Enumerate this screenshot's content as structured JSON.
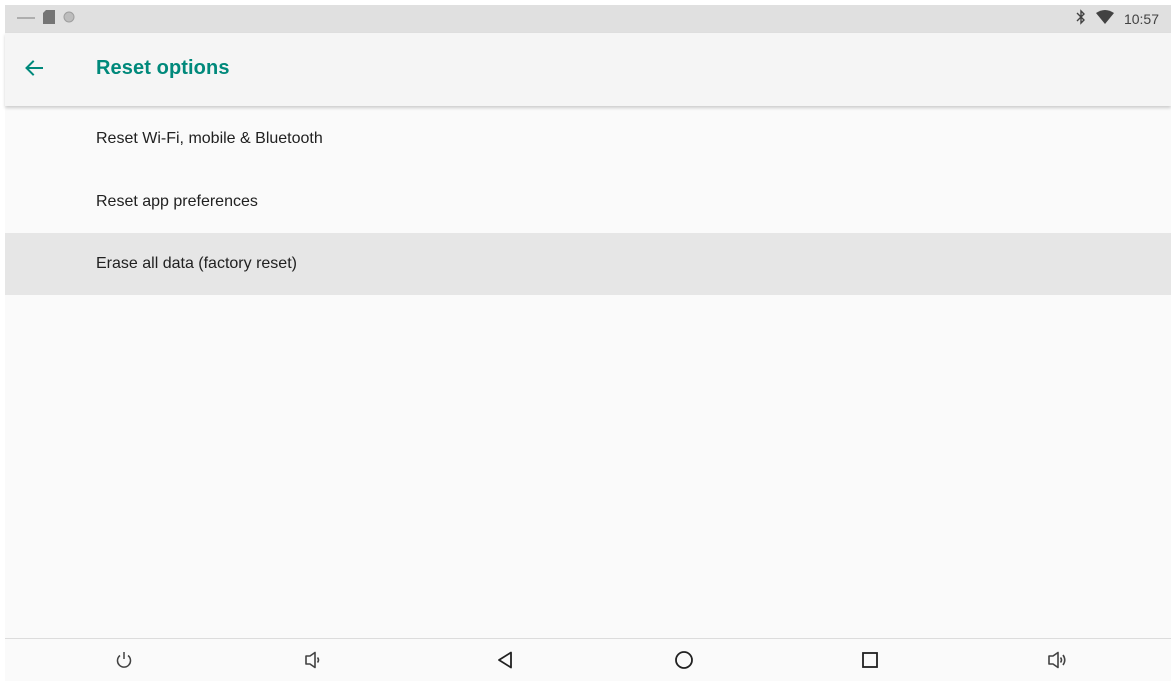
{
  "status_bar": {
    "left_icons": [
      "minimize-line-icon",
      "sd-card-icon",
      "circle-notification-icon"
    ],
    "right_icons": [
      "bluetooth-icon",
      "wifi-icon"
    ],
    "time": "10:57"
  },
  "app_bar": {
    "back_icon": "arrow-left-icon",
    "title": "Reset options",
    "accent_color": "#00897b"
  },
  "reset_list": {
    "items": [
      {
        "label": "Reset Wi-Fi, mobile & Bluetooth",
        "selected": false
      },
      {
        "label": "Reset app preferences",
        "selected": false
      },
      {
        "label": "Erase all data (factory reset)",
        "selected": true
      }
    ]
  },
  "nav_bar": {
    "buttons": [
      "power-icon",
      "volume-down-icon",
      "back-triangle-icon",
      "home-circle-icon",
      "recents-square-icon",
      "volume-up-icon"
    ]
  }
}
